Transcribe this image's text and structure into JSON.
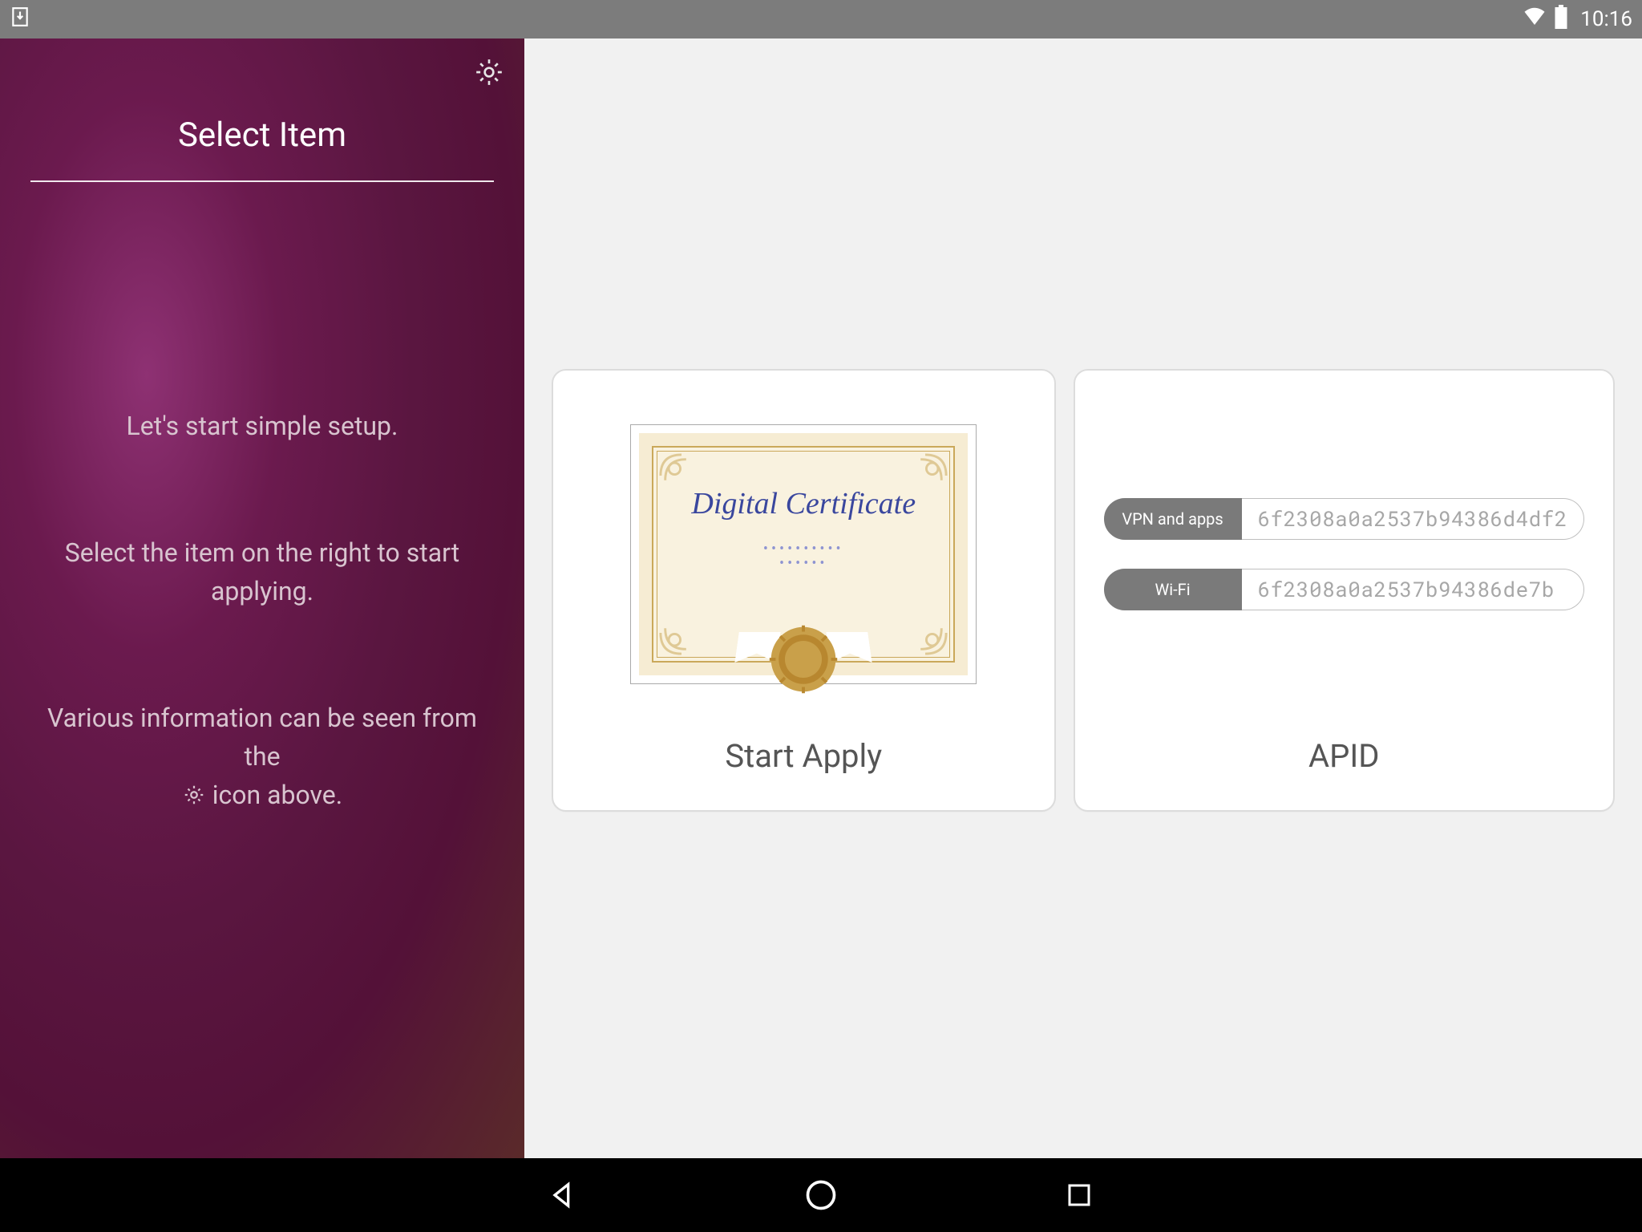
{
  "statusbar": {
    "time": "10:16"
  },
  "sidebar": {
    "title": "Select Item",
    "line1": "Let's start simple setup.",
    "line2": "Select the item on the right to start applying.",
    "line3a": "Various information can be seen from the",
    "line3b": "icon above."
  },
  "cards": {
    "startApply": {
      "title": "Start Apply",
      "certificateText": "Digital Certificate"
    },
    "apid": {
      "title": "APID",
      "rows": [
        {
          "label": "VPN and apps",
          "value": "6f2308a0a2537b94386d4df2"
        },
        {
          "label": "Wi-Fi",
          "value": "6f2308a0a2537b94386de7b"
        }
      ]
    }
  }
}
